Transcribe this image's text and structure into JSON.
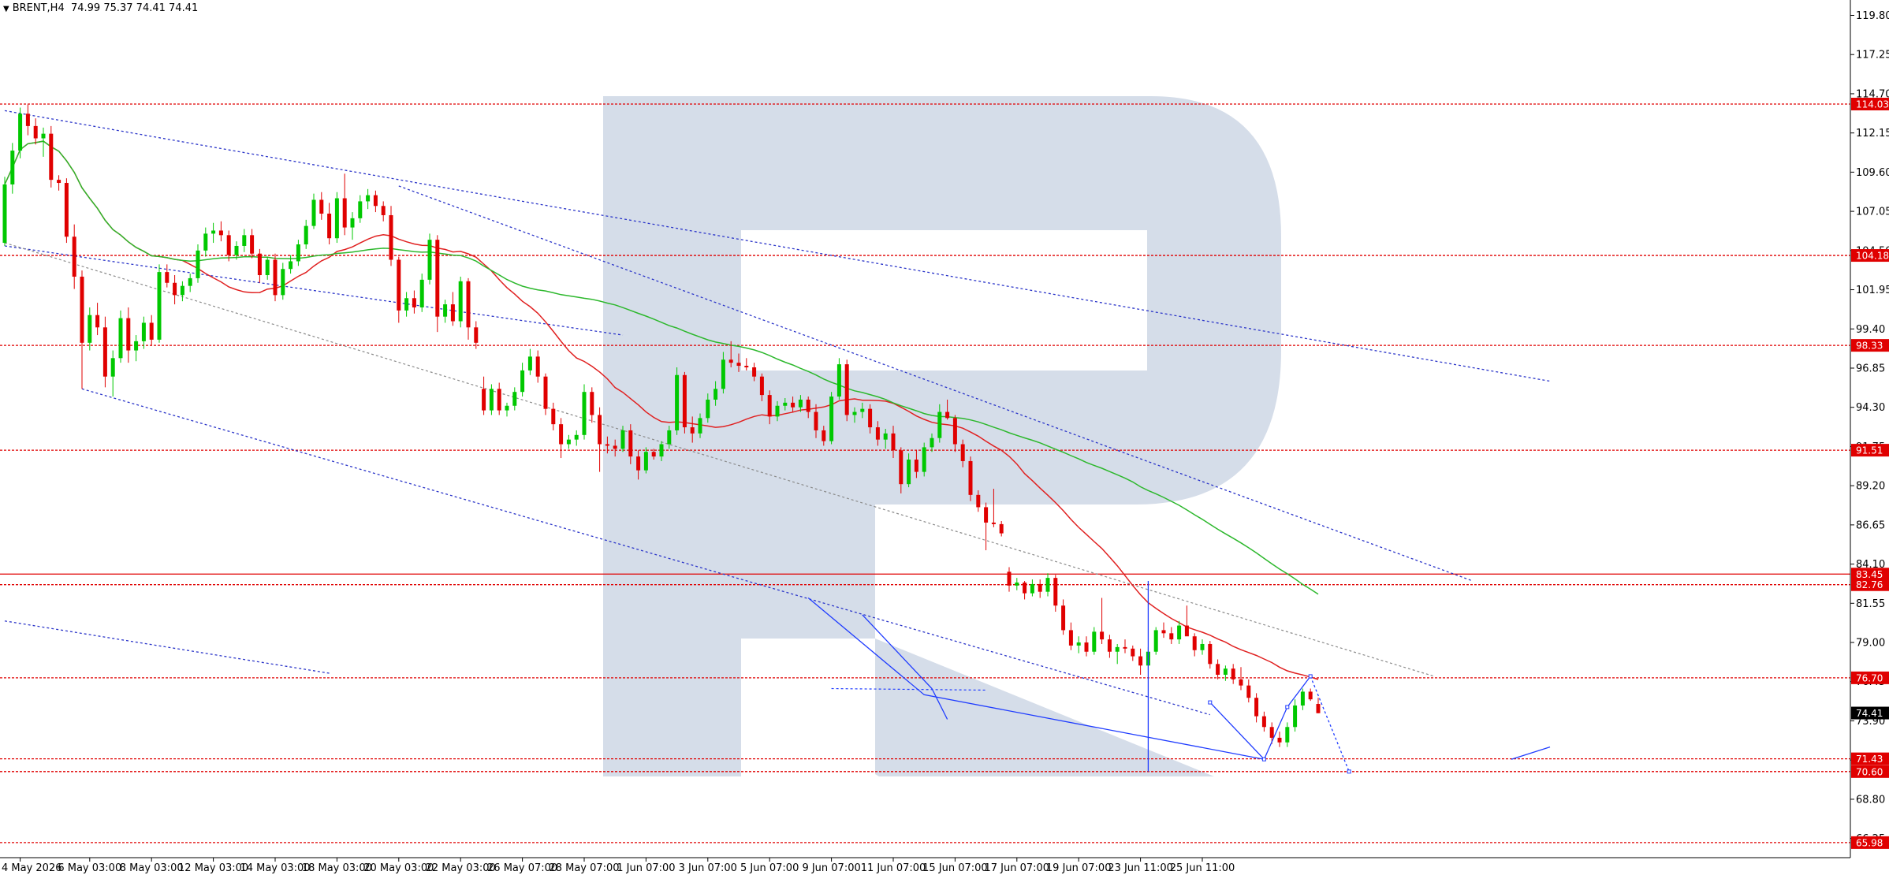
{
  "header": {
    "symbol": "BRENT,H4",
    "ohlc": "74.99 75.37 74.41 74.41"
  },
  "colors": {
    "bull": "#00c800",
    "bear": "#e00000",
    "ma_fast": "#e02020",
    "ma_slow": "#2db82d",
    "channel": "#2b35c9",
    "level": "#e00000",
    "forecast": "#1f3cff",
    "watermark": "#d5dde9",
    "price_tag": "#000000"
  },
  "chart_data": {
    "type": "candlestick",
    "ylim": [
      65.0,
      120.8
    ],
    "x_range": [
      0,
      200
    ],
    "y_ticks": [
      "119.80",
      "117.25",
      "114.70",
      "112.15",
      "109.60",
      "107.05",
      "104.50",
      "101.95",
      "99.40",
      "96.85",
      "94.30",
      "91.75",
      "89.20",
      "86.65",
      "84.10",
      "81.55",
      "79.00",
      "76.45",
      "73.90",
      "71.35",
      "68.80",
      "66.25"
    ],
    "x_labels": [
      {
        "i": 2,
        "label": "4 May 2026"
      },
      {
        "i": 11,
        "label": "6 May 03:00"
      },
      {
        "i": 19,
        "label": "8 May 03:00"
      },
      {
        "i": 27,
        "label": "12 May 03:00"
      },
      {
        "i": 35,
        "label": "14 May 03:00"
      },
      {
        "i": 43,
        "label": "18 May 03:00"
      },
      {
        "i": 51,
        "label": "20 May 03:00"
      },
      {
        "i": 59,
        "label": "22 May 03:00"
      },
      {
        "i": 67,
        "label": "26 May 07:00"
      },
      {
        "i": 75,
        "label": "28 May 07:00"
      },
      {
        "i": 83,
        "label": "1 Jun 07:00"
      },
      {
        "i": 91,
        "label": "3 Jun 07:00"
      },
      {
        "i": 99,
        "label": "5 Jun 07:00"
      },
      {
        "i": 107,
        "label": "9 Jun 07:00"
      },
      {
        "i": 115,
        "label": "11 Jun 07:00"
      },
      {
        "i": 123,
        "label": "15 Jun 07:00"
      },
      {
        "i": 131,
        "label": "17 Jun 07:00"
      },
      {
        "i": 139,
        "label": "19 Jun 07:00"
      },
      {
        "i": 147,
        "label": "23 Jun 11:00"
      },
      {
        "i": 155,
        "label": "25 Jun 11:00"
      }
    ],
    "levels": [
      {
        "value": 114.03,
        "label": "114.03",
        "style": "dotted"
      },
      {
        "value": 104.18,
        "label": "104.18",
        "style": "dotted"
      },
      {
        "value": 98.33,
        "label": "98.33",
        "style": "dotted"
      },
      {
        "value": 91.51,
        "label": "91.51",
        "style": "dotted"
      },
      {
        "value": 83.45,
        "label": "83.45",
        "style": "solid"
      },
      {
        "value": 82.76,
        "label": "82.76",
        "style": "dotted"
      },
      {
        "value": 76.7,
        "label": "76.70",
        "style": "dotted"
      },
      {
        "value": 71.43,
        "label": "71.43",
        "style": "dotted"
      },
      {
        "value": 70.6,
        "label": "70.60",
        "style": "dotted"
      },
      {
        "value": 65.98,
        "label": "65.98",
        "style": "dotted"
      }
    ],
    "current_price": {
      "value": 74.41,
      "label": "74.41"
    },
    "candles": [
      [
        105.0,
        109.3,
        104.8,
        108.8
      ],
      [
        108.8,
        111.5,
        108.2,
        111.0
      ],
      [
        111.0,
        113.8,
        110.5,
        113.4
      ],
      [
        113.4,
        114.0,
        112.0,
        112.6
      ],
      [
        112.6,
        113.1,
        111.4,
        111.8
      ],
      [
        111.8,
        112.5,
        110.6,
        112.1
      ],
      [
        112.1,
        112.6,
        108.6,
        109.1
      ],
      [
        109.1,
        109.4,
        108.4,
        108.9
      ],
      [
        108.9,
        109.2,
        105.0,
        105.4
      ],
      [
        105.4,
        106.2,
        102.0,
        102.8
      ],
      [
        102.8,
        103.2,
        95.5,
        98.5
      ],
      [
        98.5,
        100.8,
        98.0,
        100.3
      ],
      [
        100.3,
        101.1,
        99.0,
        99.5
      ],
      [
        99.5,
        100.2,
        95.6,
        96.3
      ],
      [
        96.3,
        98.0,
        95.0,
        97.5
      ],
      [
        97.5,
        100.6,
        97.2,
        100.1
      ],
      [
        100.1,
        100.8,
        97.2,
        98.0
      ],
      [
        98.0,
        99.0,
        97.3,
        98.6
      ],
      [
        98.6,
        100.2,
        98.1,
        99.8
      ],
      [
        99.8,
        100.3,
        98.3,
        98.7
      ],
      [
        98.7,
        103.6,
        98.5,
        103.1
      ],
      [
        103.1,
        103.6,
        102.1,
        102.4
      ],
      [
        102.4,
        102.9,
        101.0,
        101.6
      ],
      [
        101.6,
        102.5,
        101.2,
        102.2
      ],
      [
        102.2,
        103.0,
        101.8,
        102.7
      ],
      [
        102.7,
        104.9,
        102.4,
        104.5
      ],
      [
        104.5,
        106.0,
        104.1,
        105.6
      ],
      [
        105.6,
        106.3,
        105.0,
        105.8
      ],
      [
        105.8,
        106.4,
        105.1,
        105.5
      ],
      [
        105.5,
        105.8,
        103.8,
        104.2
      ],
      [
        104.2,
        105.1,
        103.9,
        104.8
      ],
      [
        104.8,
        105.9,
        104.4,
        105.5
      ],
      [
        105.5,
        105.9,
        104.0,
        104.3
      ],
      [
        104.3,
        104.6,
        102.4,
        102.9
      ],
      [
        102.9,
        104.1,
        102.6,
        103.9
      ],
      [
        103.9,
        104.3,
        101.2,
        101.6
      ],
      [
        101.6,
        103.7,
        101.3,
        103.3
      ],
      [
        103.3,
        104.2,
        103.0,
        103.8
      ],
      [
        103.8,
        105.2,
        103.5,
        104.9
      ],
      [
        104.9,
        106.5,
        104.6,
        106.1
      ],
      [
        106.1,
        108.2,
        105.9,
        107.8
      ],
      [
        107.8,
        108.3,
        106.5,
        106.9
      ],
      [
        106.9,
        107.6,
        104.9,
        105.3
      ],
      [
        105.3,
        108.3,
        105.0,
        107.9
      ],
      [
        107.9,
        109.5,
        105.5,
        106.0
      ],
      [
        106.0,
        107.0,
        105.2,
        106.6
      ],
      [
        106.6,
        108.1,
        106.3,
        107.7
      ],
      [
        107.7,
        108.5,
        107.2,
        108.1
      ],
      [
        108.1,
        108.4,
        107.0,
        107.4
      ],
      [
        107.4,
        107.7,
        106.4,
        106.8
      ],
      [
        106.8,
        107.4,
        103.5,
        103.9
      ],
      [
        103.9,
        104.1,
        99.8,
        100.6
      ],
      [
        100.6,
        101.8,
        100.2,
        101.4
      ],
      [
        101.4,
        101.9,
        100.4,
        100.8
      ],
      [
        100.8,
        103.0,
        100.5,
        102.6
      ],
      [
        102.6,
        105.6,
        102.3,
        105.2
      ],
      [
        105.2,
        105.5,
        99.2,
        100.2
      ],
      [
        100.2,
        101.3,
        99.8,
        101.0
      ],
      [
        101.0,
        101.8,
        99.6,
        99.9
      ],
      [
        99.9,
        102.8,
        99.5,
        102.5
      ],
      [
        102.5,
        102.7,
        98.7,
        99.5
      ],
      [
        99.5,
        99.9,
        98.1,
        98.5
      ],
      [
        95.5,
        96.3,
        93.8,
        94.1
      ],
      [
        94.1,
        95.8,
        93.8,
        95.5
      ],
      [
        95.5,
        95.9,
        93.8,
        94.1
      ],
      [
        94.1,
        94.6,
        93.7,
        94.4
      ],
      [
        94.4,
        95.6,
        94.1,
        95.3
      ],
      [
        95.3,
        97.2,
        95.0,
        96.7
      ],
      [
        96.7,
        98.1,
        96.4,
        97.6
      ],
      [
        97.6,
        98.0,
        95.9,
        96.3
      ],
      [
        96.3,
        96.5,
        93.8,
        94.2
      ],
      [
        94.2,
        94.6,
        92.8,
        93.2
      ],
      [
        93.2,
        93.6,
        91.0,
        91.9
      ],
      [
        91.9,
        92.5,
        91.6,
        92.2
      ],
      [
        92.2,
        92.8,
        91.8,
        92.5
      ],
      [
        92.5,
        95.8,
        92.2,
        95.3
      ],
      [
        95.3,
        95.6,
        93.3,
        93.8
      ],
      [
        93.8,
        94.3,
        90.1,
        91.9
      ],
      [
        91.9,
        92.4,
        91.3,
        91.8
      ],
      [
        91.8,
        92.2,
        91.1,
        91.6
      ],
      [
        91.6,
        93.1,
        91.4,
        92.8
      ],
      [
        92.8,
        93.2,
        90.6,
        91.1
      ],
      [
        91.1,
        91.5,
        89.6,
        90.2
      ],
      [
        90.2,
        91.7,
        90.0,
        91.4
      ],
      [
        91.4,
        91.6,
        90.9,
        91.1
      ],
      [
        91.1,
        92.1,
        90.8,
        91.9
      ],
      [
        91.9,
        93.1,
        91.6,
        92.8
      ],
      [
        92.8,
        96.9,
        92.5,
        96.4
      ],
      [
        96.4,
        96.6,
        92.6,
        93.0
      ],
      [
        93.0,
        93.7,
        92.0,
        92.6
      ],
      [
        92.6,
        93.9,
        92.3,
        93.6
      ],
      [
        93.6,
        95.2,
        93.3,
        94.8
      ],
      [
        94.8,
        96.0,
        94.4,
        95.5
      ],
      [
        95.5,
        97.9,
        95.2,
        97.4
      ],
      [
        97.4,
        98.6,
        96.9,
        97.2
      ],
      [
        97.2,
        97.8,
        96.6,
        97.0
      ],
      [
        97.0,
        97.5,
        96.7,
        96.9
      ],
      [
        96.9,
        97.2,
        96.0,
        96.3
      ],
      [
        96.3,
        96.5,
        94.7,
        95.1
      ],
      [
        95.1,
        95.4,
        93.2,
        93.7
      ],
      [
        93.7,
        94.7,
        93.4,
        94.4
      ],
      [
        94.4,
        94.9,
        94.1,
        94.6
      ],
      [
        94.6,
        95.0,
        94.0,
        94.3
      ],
      [
        94.3,
        95.1,
        94.0,
        94.8
      ],
      [
        94.8,
        95.0,
        93.6,
        94.0
      ],
      [
        94.0,
        94.5,
        92.3,
        92.8
      ],
      [
        92.8,
        93.1,
        91.8,
        92.1
      ],
      [
        92.1,
        95.3,
        91.9,
        95.0
      ],
      [
        95.0,
        97.5,
        94.8,
        97.1
      ],
      [
        97.1,
        97.4,
        93.4,
        93.8
      ],
      [
        93.8,
        94.3,
        93.3,
        94.0
      ],
      [
        94.0,
        94.6,
        93.6,
        94.2
      ],
      [
        94.2,
        94.5,
        92.6,
        93.0
      ],
      [
        93.0,
        93.4,
        91.8,
        92.2
      ],
      [
        92.2,
        92.9,
        91.6,
        92.6
      ],
      [
        92.6,
        93.1,
        91.0,
        91.5
      ],
      [
        91.5,
        91.7,
        88.7,
        89.3
      ],
      [
        89.3,
        91.3,
        89.1,
        90.9
      ],
      [
        90.9,
        91.5,
        89.7,
        90.1
      ],
      [
        90.1,
        92.0,
        89.8,
        91.7
      ],
      [
        91.7,
        92.6,
        91.4,
        92.3
      ],
      [
        92.3,
        94.5,
        92.0,
        94.0
      ],
      [
        94.0,
        94.8,
        93.5,
        93.6
      ],
      [
        93.6,
        93.8,
        91.4,
        91.9
      ],
      [
        91.9,
        92.2,
        90.4,
        90.8
      ],
      [
        90.8,
        91.1,
        88.2,
        88.6
      ],
      [
        88.6,
        88.9,
        87.5,
        87.8
      ],
      [
        87.8,
        88.1,
        85.0,
        86.8
      ],
      [
        86.8,
        89.0,
        86.5,
        86.7
      ],
      [
        86.7,
        86.9,
        85.9,
        86.1
      ],
      [
        83.6,
        83.9,
        82.3,
        82.7
      ],
      [
        82.7,
        83.2,
        82.4,
        82.9
      ],
      [
        82.9,
        83.0,
        81.8,
        82.2
      ],
      [
        82.2,
        83.1,
        82.0,
        82.8
      ],
      [
        82.8,
        83.1,
        81.9,
        82.3
      ],
      [
        82.3,
        83.5,
        82.0,
        83.2
      ],
      [
        83.2,
        83.4,
        81.0,
        81.4
      ],
      [
        81.4,
        81.8,
        79.5,
        79.8
      ],
      [
        79.8,
        80.3,
        78.5,
        78.8
      ],
      [
        78.8,
        79.4,
        78.3,
        79.0
      ],
      [
        79.0,
        79.4,
        78.1,
        78.4
      ],
      [
        78.4,
        80.0,
        78.2,
        79.7
      ],
      [
        79.7,
        81.9,
        78.9,
        79.2
      ],
      [
        79.2,
        79.5,
        78.0,
        78.4
      ],
      [
        78.4,
        78.9,
        77.6,
        78.7
      ],
      [
        78.7,
        79.2,
        78.3,
        78.6
      ],
      [
        78.6,
        78.8,
        77.8,
        78.1
      ],
      [
        78.1,
        78.6,
        76.9,
        77.5
      ],
      [
        77.5,
        78.7,
        77.2,
        78.4
      ],
      [
        78.4,
        80.0,
        78.2,
        79.8
      ],
      [
        79.8,
        80.3,
        79.3,
        79.6
      ],
      [
        79.6,
        80.0,
        78.9,
        79.2
      ],
      [
        79.2,
        80.4,
        78.9,
        80.1
      ],
      [
        80.1,
        81.4,
        79.6,
        79.4
      ],
      [
        79.4,
        79.6,
        78.1,
        78.5
      ],
      [
        78.5,
        79.2,
        78.2,
        78.9
      ],
      [
        78.9,
        79.1,
        77.3,
        77.6
      ],
      [
        77.6,
        77.9,
        76.6,
        76.9
      ],
      [
        76.9,
        77.5,
        76.5,
        77.3
      ],
      [
        77.3,
        77.6,
        76.3,
        76.6
      ],
      [
        76.6,
        77.4,
        75.9,
        76.2
      ],
      [
        76.2,
        76.6,
        75.1,
        75.4
      ],
      [
        75.4,
        75.7,
        73.8,
        74.2
      ],
      [
        74.2,
        74.5,
        73.2,
        73.5
      ],
      [
        73.5,
        73.8,
        72.4,
        72.8
      ],
      [
        72.8,
        73.2,
        72.2,
        72.5
      ],
      [
        72.5,
        73.8,
        72.2,
        73.5
      ],
      [
        73.5,
        75.3,
        73.2,
        74.9
      ],
      [
        74.9,
        76.0,
        74.6,
        75.8
      ],
      [
        75.8,
        76.0,
        75.2,
        75.3
      ],
      [
        75.0,
        75.4,
        74.4,
        74.4
      ]
    ]
  }
}
